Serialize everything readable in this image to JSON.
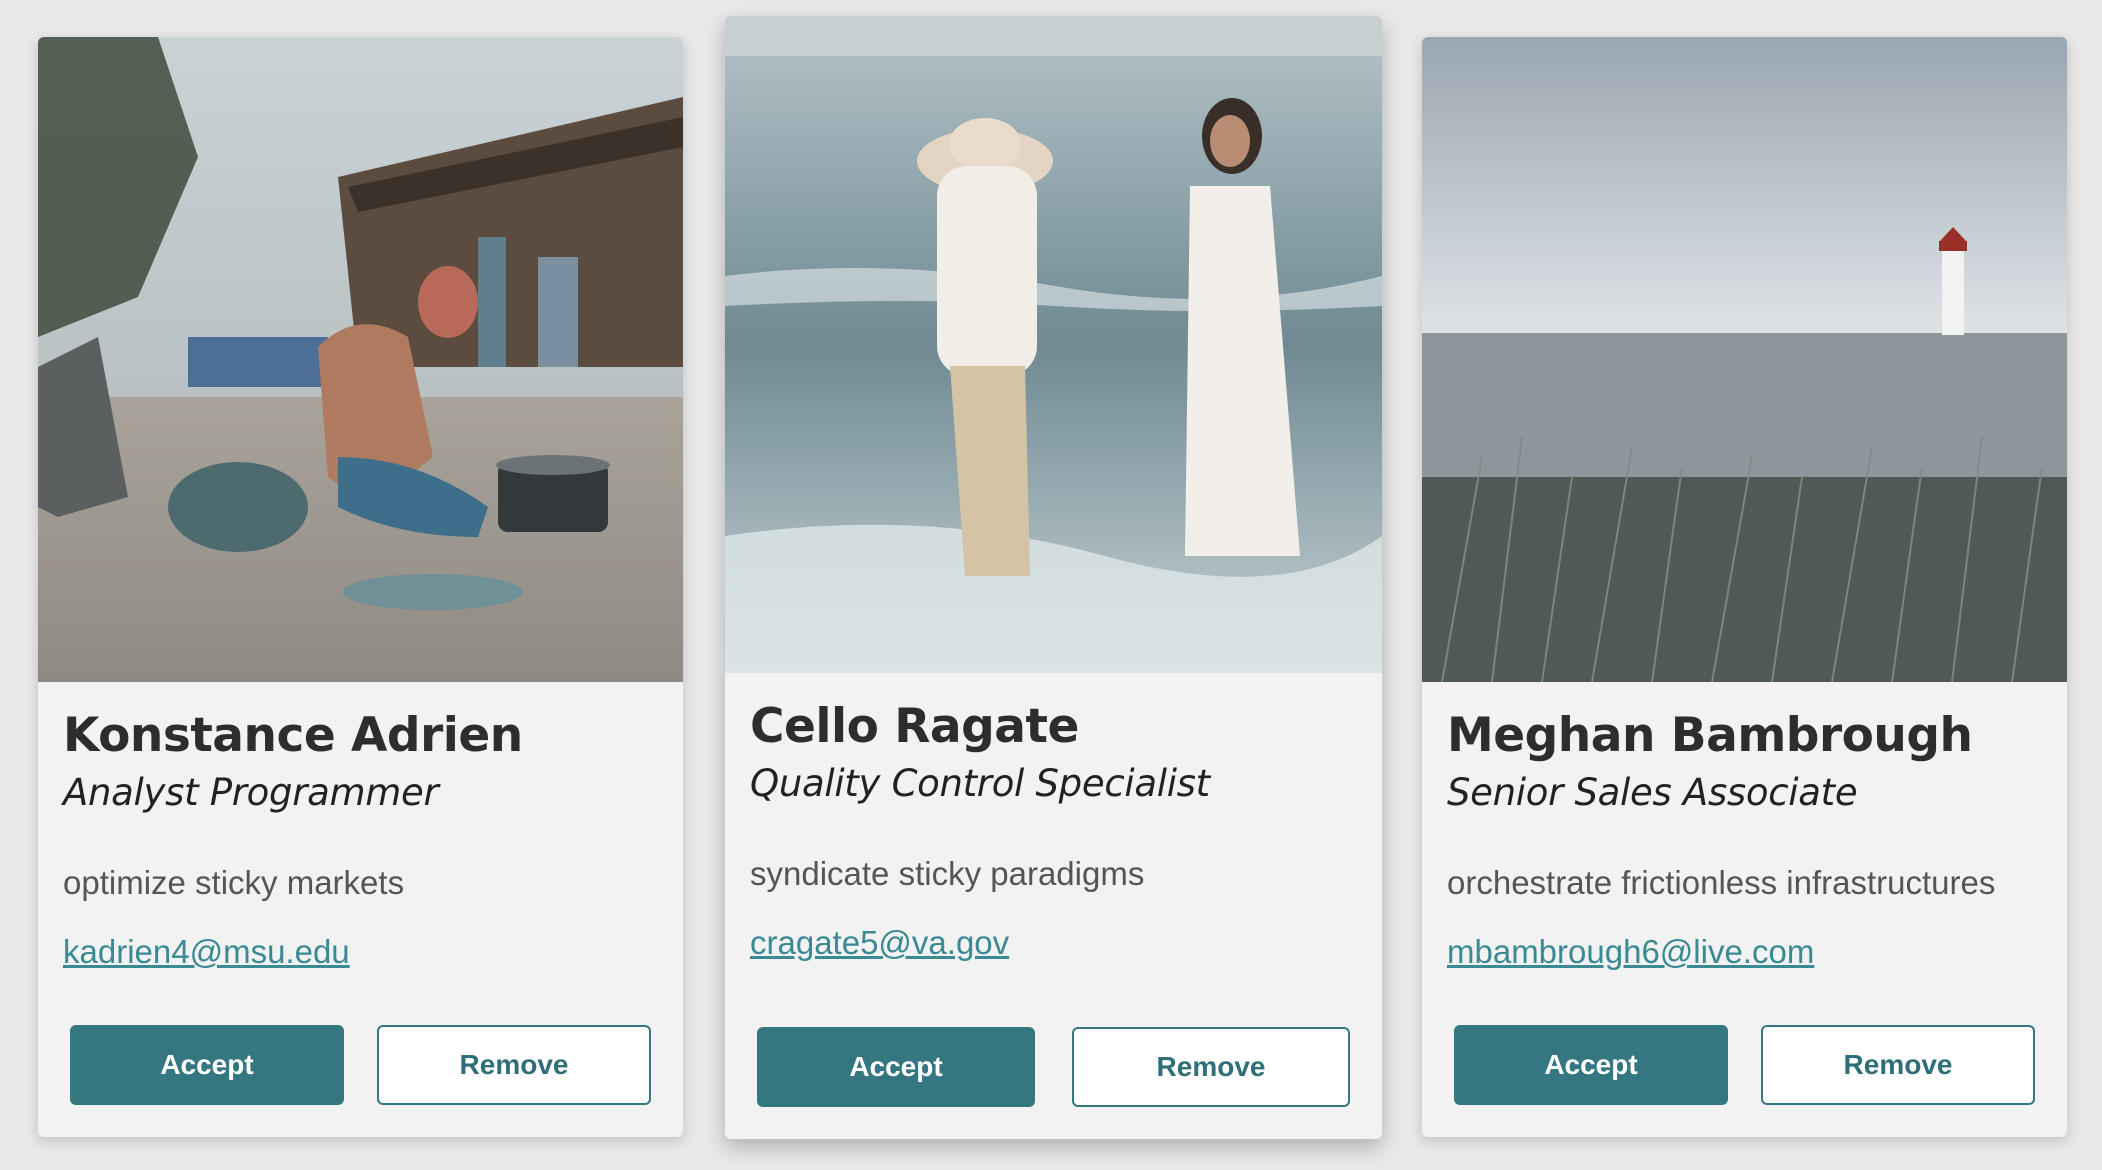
{
  "cards": [
    {
      "name": "Konstance Adrien",
      "job_title": "Analyst Programmer",
      "tagline": "optimize sticky markets",
      "email": "kadrien4@msu.edu",
      "accept_label": "Accept",
      "remove_label": "Remove"
    },
    {
      "name": "Cello Ragate",
      "job_title": "Quality Control Specialist",
      "tagline": "syndicate sticky paradigms",
      "email": "cragate5@va.gov",
      "accept_label": "Accept",
      "remove_label": "Remove"
    },
    {
      "name": "Meghan Bambrough",
      "job_title": "Senior Sales Associate",
      "tagline": "orchestrate frictionless infrastructures",
      "email": "mbambrough6@live.com",
      "accept_label": "Accept",
      "remove_label": "Remove"
    }
  ],
  "colors": {
    "accent": "#347780",
    "link": "#3a8a93",
    "card_bg": "#f2f2f2",
    "page_bg": "#e9e9e9"
  }
}
